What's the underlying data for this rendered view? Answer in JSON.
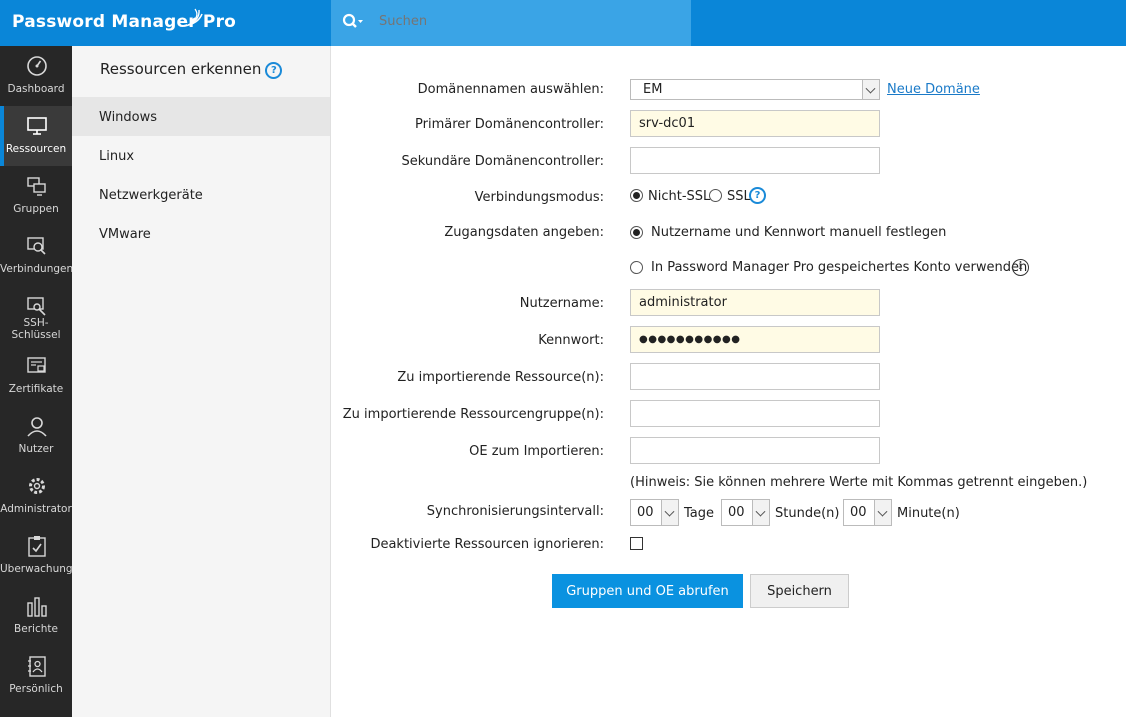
{
  "app": {
    "title": "Password Manager Pro",
    "search_placeholder": "Suchen"
  },
  "nav": [
    {
      "label": "Dashboard",
      "icon": "dashboard-icon"
    },
    {
      "label": "Ressourcen",
      "icon": "monitor-icon",
      "active": true
    },
    {
      "label": "Gruppen",
      "icon": "groups-icon"
    },
    {
      "label": "Verbindungen",
      "icon": "connections-icon"
    },
    {
      "label": "SSH-\nSchlüssel",
      "icon": "ssh-key-icon"
    },
    {
      "label": "Zertifikate",
      "icon": "certificate-icon"
    },
    {
      "label": "Nutzer",
      "icon": "user-icon"
    },
    {
      "label": "Administrator",
      "icon": "gear-icon"
    },
    {
      "label": "Überwachung",
      "icon": "clipboard-icon"
    },
    {
      "label": "Berichte",
      "icon": "reports-icon"
    },
    {
      "label": "Persönlich",
      "icon": "contacts-icon"
    }
  ],
  "sidebar": {
    "title": "Ressourcen erkennen",
    "help": "?",
    "items": [
      "Windows",
      "Linux",
      "Netzwerkgeräte",
      "VMware"
    ],
    "active": "Windows"
  },
  "form": {
    "domain_label": "Domänennamen auswählen:",
    "domain_value": "EM",
    "new_domain_link": "Neue Domäne",
    "primary_dc_label": "Primärer Domänencontroller:",
    "primary_dc_value": "srv-dc01",
    "secondary_dc_label": "Sekundäre Domänencontroller:",
    "secondary_dc_value": "",
    "connection_label": "Verbindungsmodus:",
    "connection_options": [
      "Nicht-SSL",
      "SSL"
    ],
    "connection_selected": "Nicht-SSL",
    "credentials_label": "Zugangsdaten angeben:",
    "credentials_options": [
      "Nutzername und Kennwort manuell festlegen",
      "In Password Manager Pro gespeichertes Konto verwenden"
    ],
    "credentials_selected": "Nutzername und Kennwort manuell festlegen",
    "username_label": "Nutzername:",
    "username_value": "administrator",
    "password_label": "Kennwort:",
    "password_value": "●●●●●●●●●●●",
    "resources_label": "Zu importierende Ressource(n):",
    "resource_groups_label": "Zu importierende Ressourcengruppe(n):",
    "ou_label": "OE zum Importieren:",
    "hint": "(Hinweis: Sie können mehrere Werte mit Kommas getrennt eingeben.)",
    "sync_label": "Synchronisierungsintervall:",
    "sync_days": "00",
    "sync_days_unit": "Tage",
    "sync_hours": "00",
    "sync_hours_unit": "Stunde(n)",
    "sync_minutes": "00",
    "sync_minutes_unit": "Minute(n)",
    "ignore_disabled_label": "Deaktivierte Ressourcen ignorieren:",
    "ignore_disabled_checked": false,
    "info_icon": "i",
    "fetch_button": "Gruppen und OE abrufen",
    "save_button": "Speichern"
  },
  "colors": {
    "accent": "#0a86d8",
    "search_bg": "#3aa4e6",
    "nav_bg": "#272727",
    "filled_input": "#fffbe5",
    "primary_button": "#0a92e0"
  }
}
